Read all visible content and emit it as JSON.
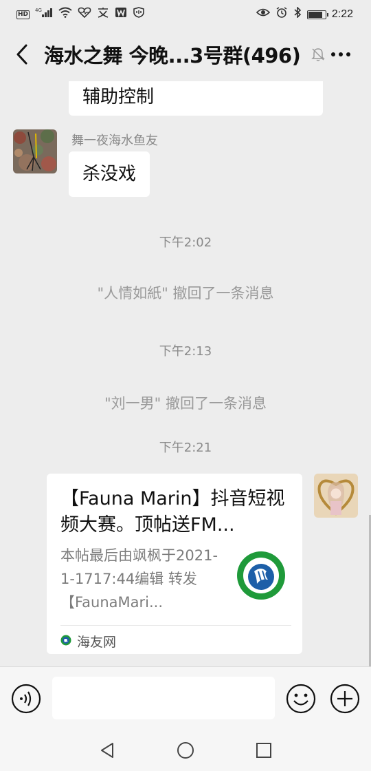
{
  "status_bar": {
    "hd": "HD",
    "signal": "4G",
    "time": "2:22",
    "battery_level": 0.85,
    "left_icons": [
      "hd-icon",
      "signal-icon",
      "wifi-icon",
      "health-icon",
      "translate-icon",
      "wps-icon",
      "shield-icon"
    ],
    "right_icons": [
      "eye-icon",
      "alarm-icon",
      "bluetooth-icon",
      "battery-icon"
    ]
  },
  "header": {
    "title": "海水之舞 今晚...3号群(496)",
    "icons": [
      "back-icon",
      "mute-icon",
      "more-icon"
    ]
  },
  "messages": {
    "first_bubble": "辅助控制",
    "sender_name": "舞一夜海水鱼友",
    "second_bubble": "杀没戏",
    "time_1": "下午2:02",
    "recall_1": "\"人情如紙\" 撤回了一条消息",
    "time_2": "下午2:13",
    "recall_2": "\"刘一男\" 撤回了一条消息",
    "time_3": "下午2:21"
  },
  "card": {
    "title": "【Fauna Marin】抖音短视频大赛。顶帖送FM...",
    "desc": "本帖最后由飒枫于2021-1-1717:44编辑 转发【FaunaMari...",
    "source": "海友网"
  },
  "input": {
    "value": ""
  },
  "colors": {
    "chat_bg": "#ededed",
    "bubble": "#ffffff",
    "system_text": "#8a8a8a",
    "logo_green": "#1f9a3a",
    "logo_blue": "#1d5fa8"
  }
}
